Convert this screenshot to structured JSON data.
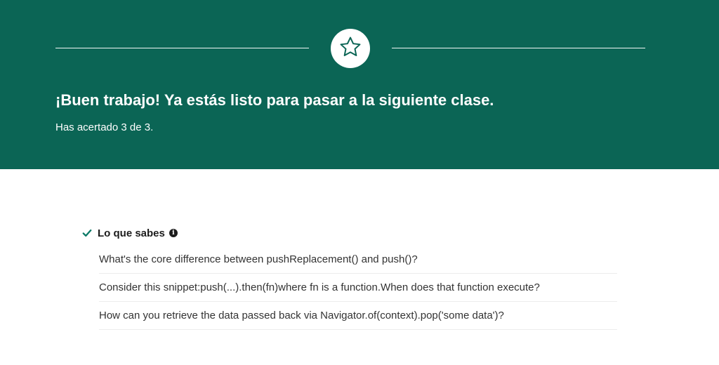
{
  "banner": {
    "icon": "star-icon",
    "background_color": "#0b6555",
    "headline": "¡Buen trabajo! Ya estás listo para pasar a la siguiente clase.",
    "score_text": "Has acertado 3 de 3."
  },
  "results": {
    "section_title": "Lo que sabes",
    "section_icon": "check-icon",
    "info_icon": "info-icon",
    "accent_color": "#0b7a67",
    "questions": [
      "What's the core difference between pushReplacement() and push()?",
      "Consider this snippet:push(...).then(fn)where fn is a function.When does that function execute?",
      "How can you retrieve the data passed back via Navigator.of(context).pop('some data')?"
    ]
  }
}
